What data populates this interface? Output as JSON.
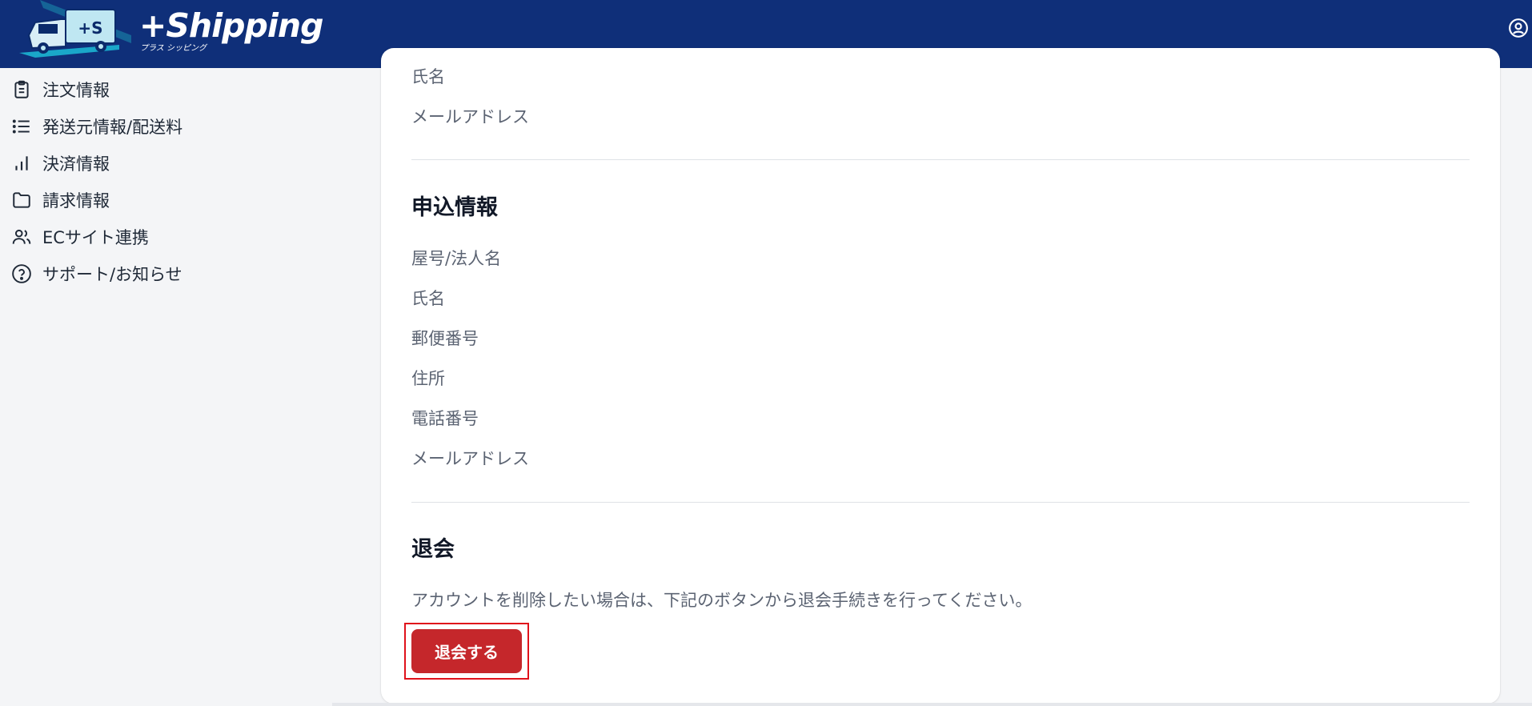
{
  "header": {
    "logo_text": "+Shipping",
    "logo_subtext": "プラス シッピング",
    "account_icon": "user-circle-icon",
    "brand_color": "#0f2f79"
  },
  "sidebar": {
    "items": [
      {
        "label": "注文情報",
        "icon": "clipboard-icon"
      },
      {
        "label": "発送元情報/配送料",
        "icon": "list-icon"
      },
      {
        "label": "決済情報",
        "icon": "bar-chart-icon"
      },
      {
        "label": "請求情報",
        "icon": "folder-icon"
      },
      {
        "label": "ECサイト連携",
        "icon": "users-icon"
      },
      {
        "label": "サポート/お知らせ",
        "icon": "help-circle-icon"
      }
    ]
  },
  "main": {
    "top_fields": [
      "氏名",
      "メールアドレス"
    ],
    "application_section": {
      "title": "申込情報",
      "fields": [
        "屋号/法人名",
        "氏名",
        "郵便番号",
        "住所",
        "電話番号",
        "メールアドレス"
      ]
    },
    "withdraw_section": {
      "title": "退会",
      "notice": "アカウントを削除したい場合は、下記のボタンから退会手続きを行ってください。",
      "button_label": "退会する",
      "button_color": "#c5272b",
      "highlight_color": "#e0121b"
    }
  }
}
